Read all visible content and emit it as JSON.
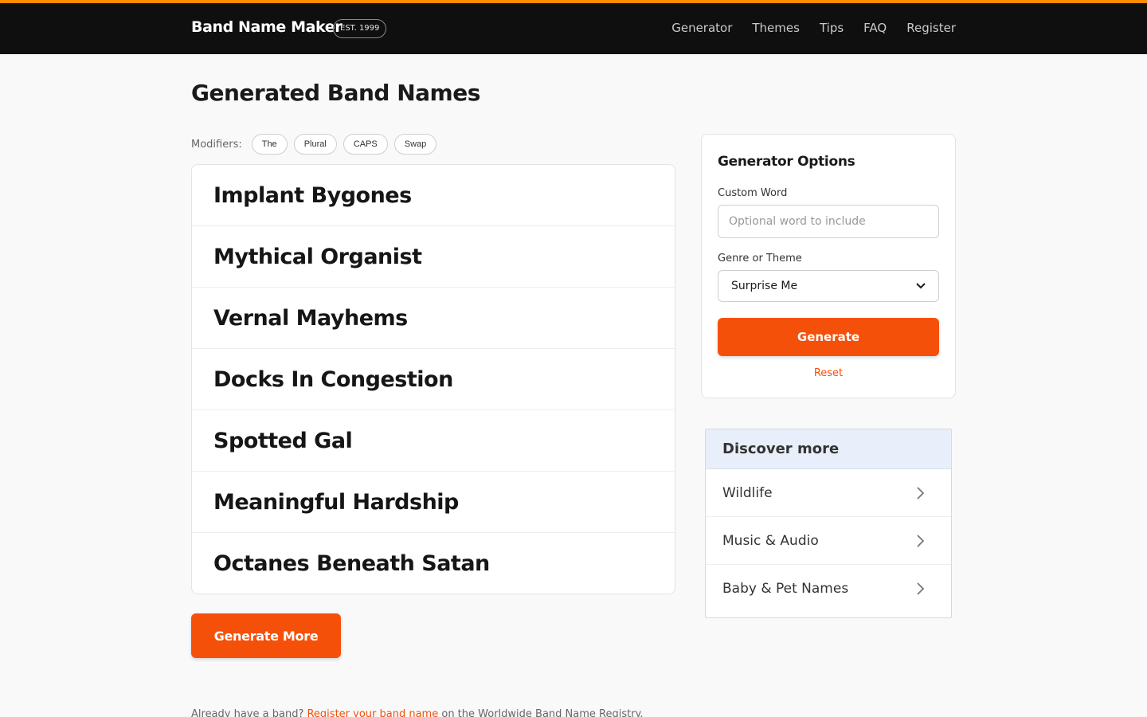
{
  "header": {
    "brand": "Band Name Maker",
    "badge": "EST. 1999",
    "nav": [
      "Generator",
      "Themes",
      "Tips",
      "FAQ",
      "Register"
    ]
  },
  "page": {
    "title": "Generated Band Names",
    "modifiers_label": "Modifiers:",
    "modifiers": [
      "The",
      "Plural",
      "CAPS",
      "Swap"
    ]
  },
  "names": [
    "Implant Bygones",
    "Mythical Organist",
    "Vernal Mayhems",
    "Docks In Congestion",
    "Spotted Gal",
    "Meaningful Hardship",
    "Octanes Beneath Satan"
  ],
  "generate_more_label": "Generate More",
  "options": {
    "title": "Generator Options",
    "custom_word_label": "Custom Word",
    "custom_word_placeholder": "Optional word to include",
    "custom_word_value": "",
    "genre_label": "Genre or Theme",
    "genre_selected": "Surprise Me",
    "generate_label": "Generate",
    "reset_label": "Reset"
  },
  "discover": {
    "title": "Discover more",
    "items": [
      "Wildlife",
      "Music & Audio",
      "Baby & Pet Names"
    ]
  },
  "footer": {
    "prefix": "Already have a band?",
    "link": "Register your band name",
    "suffix": "on the Worldwide Band Name Registry."
  },
  "colors": {
    "accent": "#f5500a",
    "top_stripe": "#ff8c00",
    "navbar_bg": "#0f0f0f"
  },
  "icons": {
    "discover_item": "chevron-right-icon",
    "select": "chevron-down-icon"
  }
}
